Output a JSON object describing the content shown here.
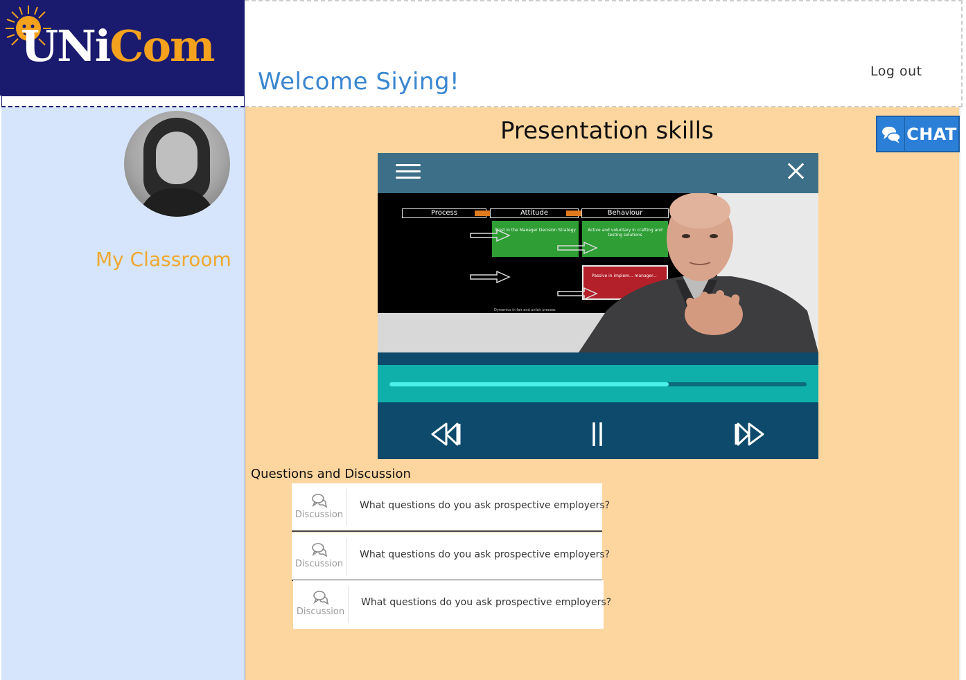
{
  "header": {
    "logo": {
      "uni": "UNi",
      "com": "Com",
      "icon": "lion-sun-icon"
    },
    "welcome": "Welcome Siying!",
    "logout_label": "Log out"
  },
  "sidebar": {
    "avatar": "avatar",
    "nav_label": "My Classroom"
  },
  "main": {
    "course_title": "Presentation skills",
    "chat_label": "CHAT",
    "video": {
      "slide": {
        "flow": [
          "Process",
          "Attitude",
          "Behaviour"
        ],
        "green_1": "Trust in the Manager Decision Strategy",
        "green_2": "Active and voluntary in crafting and testing solutions",
        "red": "Passive in implem... manager...",
        "caption": "Dynamics in fair and unfair process"
      },
      "progress_fraction": 0.67,
      "controls": [
        "rewind-icon",
        "pause-icon",
        "fast-forward-icon"
      ]
    },
    "qd_title": "Questions and Discussion",
    "questions": [
      {
        "tag": "Discussion",
        "text": "What questions do you ask prospective employers?"
      },
      {
        "tag": "Discussion",
        "text": "What questions do you ask prospective employers?"
      },
      {
        "tag": "Discussion",
        "text": "What questions do you ask prospective employers?"
      }
    ]
  },
  "colors": {
    "logo_bg": "#1a1a6e",
    "logo_accent": "#f4a21e",
    "sidebar_bg": "#d6e5fb",
    "main_bg": "#fdd59e",
    "welcome": "#3a86d0",
    "classroom": "#f0a830",
    "chat_bg": "#2b7fd6",
    "player_bg": "#0d4a6b",
    "progress_bg": "#0fb0aa"
  }
}
